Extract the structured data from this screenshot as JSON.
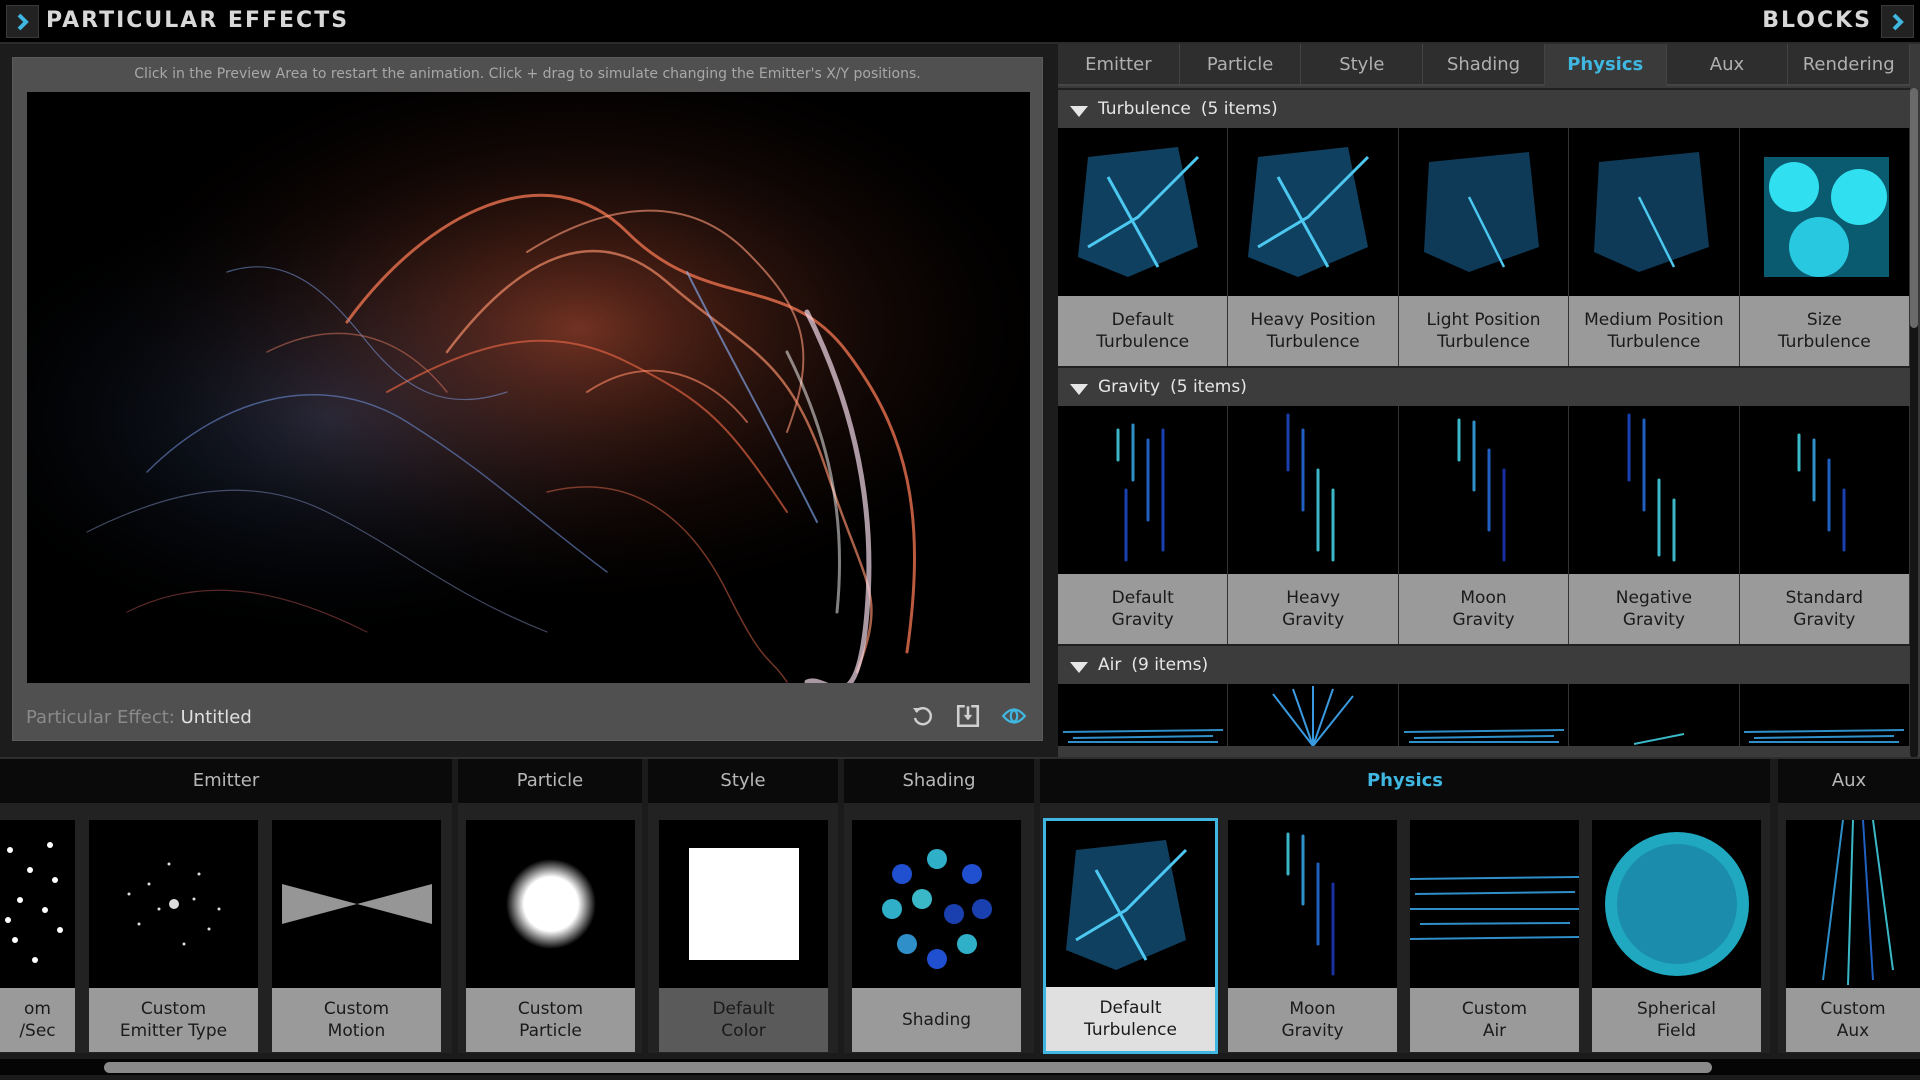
{
  "app": {
    "title": "PARTICULAR EFFECTS",
    "right_title": "BLOCKS",
    "accent": "#3fb7e0"
  },
  "preview": {
    "hint": "Click in the Preview Area to restart the animation. Click + drag to simulate changing the Emitter's X/Y positions.",
    "effect_label": "Particular Effect:",
    "effect_name": "Untitled",
    "icons": [
      "restart-icon",
      "save-icon",
      "visibility-icon"
    ]
  },
  "tabs": [
    {
      "label": "Emitter"
    },
    {
      "label": "Particle"
    },
    {
      "label": "Style"
    },
    {
      "label": "Shading"
    },
    {
      "label": "Physics",
      "active": true
    },
    {
      "label": "Aux"
    },
    {
      "label": "Rendering"
    }
  ],
  "sections": [
    {
      "title": "Turbulence",
      "count": "(5 items)",
      "items": [
        {
          "line1": "Default",
          "line2": "Turbulence"
        },
        {
          "line1": "Heavy Position",
          "line2": "Turbulence"
        },
        {
          "line1": "Light Position",
          "line2": "Turbulence"
        },
        {
          "line1": "Medium Position",
          "line2": "Turbulence"
        },
        {
          "line1": "Size",
          "line2": "Turbulence"
        }
      ]
    },
    {
      "title": "Gravity",
      "count": "(5 items)",
      "items": [
        {
          "line1": "Default",
          "line2": "Gravity"
        },
        {
          "line1": "Heavy",
          "line2": "Gravity"
        },
        {
          "line1": "Moon",
          "line2": "Gravity"
        },
        {
          "line1": "Negative",
          "line2": "Gravity"
        },
        {
          "line1": "Standard",
          "line2": "Gravity"
        }
      ]
    },
    {
      "title": "Air",
      "count": "(9 items)"
    }
  ],
  "strip": {
    "groups": [
      {
        "label": "Emitter"
      },
      {
        "label": "Particle"
      },
      {
        "label": "Style"
      },
      {
        "label": "Shading"
      },
      {
        "label": "Physics",
        "active": true
      },
      {
        "label": "Aux"
      }
    ],
    "tiles": [
      {
        "line1": "om",
        "line2": "/Sec"
      },
      {
        "line1": "Custom",
        "line2": "Emitter Type"
      },
      {
        "line1": "Custom",
        "line2": "Motion"
      },
      {
        "line1": "Custom",
        "line2": "Particle"
      },
      {
        "line1": "Default",
        "line2": "Color"
      },
      {
        "line1": "Shading",
        "line2": ""
      },
      {
        "line1": "Default",
        "line2": "Turbulence",
        "selected": true
      },
      {
        "line1": "Moon",
        "line2": "Gravity"
      },
      {
        "line1": "Custom",
        "line2": "Air"
      },
      {
        "line1": "Spherical",
        "line2": "Field"
      },
      {
        "line1": "Custom",
        "line2": "Aux"
      }
    ]
  }
}
